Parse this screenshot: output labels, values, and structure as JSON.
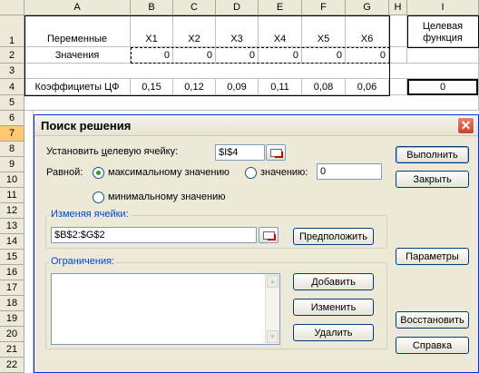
{
  "sheet": {
    "columns": [
      "A",
      "B",
      "C",
      "D",
      "E",
      "F",
      "G",
      "H",
      "I"
    ],
    "rows": [
      "1",
      "2",
      "3",
      "4",
      "5",
      "6",
      "7",
      "8",
      "9",
      "10",
      "11",
      "12",
      "13",
      "14",
      "15",
      "16",
      "17",
      "18",
      "19",
      "20",
      "21",
      "22"
    ],
    "active_row": "7",
    "a1": "Переменные",
    "vars": [
      "X1",
      "X2",
      "X3",
      "X4",
      "X5",
      "X6"
    ],
    "i1": "Целевая функция",
    "a2": "Значения",
    "values": [
      "0",
      "0",
      "0",
      "0",
      "0",
      "0"
    ],
    "a4": "Коэффициеты ЦФ",
    "coefs": [
      "0,15",
      "0,12",
      "0,09",
      "0,11",
      "0,08",
      "0,06"
    ],
    "i4": "0"
  },
  "dialog": {
    "title": "Поиск решения",
    "target_label_pre": "Установить ",
    "target_label_u": "ц",
    "target_label_post": "елевую ячейку:",
    "target_value": "$I$4",
    "equal_label": "Равной:",
    "opt_max": "максимальному значению",
    "opt_value": "значению:",
    "value_field": "0",
    "opt_min": "минимальному значению",
    "changing_label": "Изменяя ячейки:",
    "changing_value": "$B$2:$G$2",
    "constraints_label": "Ограничения:",
    "buttons": {
      "solve": "Выполнить",
      "close": "Закрыть",
      "guess": "Предположить",
      "options": "Параметры",
      "add": "Добавить",
      "change": "Изменить",
      "delete": "Удалить",
      "reset": "Восстановить",
      "help": "Справка"
    }
  }
}
